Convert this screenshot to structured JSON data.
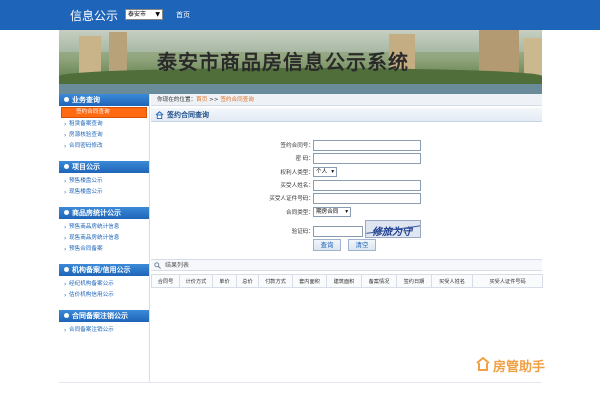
{
  "topbar": {
    "brand": "信息公示",
    "city_select": "泰安市",
    "home_link": "首页"
  },
  "banner": {
    "title": "泰安市商品房信息公示系统"
  },
  "sidebar": {
    "sections": [
      {
        "title": "业务查询",
        "items": [
          "签约合同查询",
          "租赁备案查询",
          "房源核验查询",
          "合同密码修改"
        ]
      },
      {
        "title": "项目公示",
        "items": [
          "预售楼盘公示",
          "现售楼盘公示"
        ]
      },
      {
        "title": "商品房统计公示",
        "items": [
          "预售商品房统计信息",
          "现售商品房统计信息",
          "预售合同备案"
        ]
      },
      {
        "title": "机构备案/信用公示",
        "items": [
          "经纪机构备案公示",
          "估价机构信用公示"
        ]
      },
      {
        "title": "合同备案注销公示",
        "items": [
          "合同备案注销公示"
        ]
      }
    ],
    "active_item": "签约合同查询"
  },
  "breadcrumb": {
    "lead": "你现在的位置：",
    "home": "首页",
    "sep": ">>",
    "current": "签约合同查询"
  },
  "page_title": "签约合同查询",
  "form": {
    "contract_no_label": "签约合同号：",
    "password_label": "密    码：",
    "owner_type_label": "权利人类型：",
    "owner_type_value": "个人",
    "buyer_name_label": "买受人姓名：",
    "buyer_id_label": "买受人证件号码：",
    "contract_type_label": "合同类型：",
    "contract_type_value": "期房合同",
    "captcha_label": "验证码：",
    "captcha_text": "修旅为守",
    "query_button": "查询",
    "clear_button": "清空"
  },
  "results": {
    "title": "结果列表",
    "columns": [
      "合同号",
      "计价方式",
      "单价",
      "总价",
      "付款方式",
      "套内面积",
      "建筑面积",
      "备案情况",
      "签约日期",
      "买受人姓名",
      "买受人证件号码"
    ]
  },
  "watermark": {
    "text": "房管助手"
  },
  "colors": {
    "primary": "#1e64b8",
    "active_orange": "#ff6a13",
    "crumb_orange": "#e06d1f",
    "watermark": "#f0a045"
  }
}
